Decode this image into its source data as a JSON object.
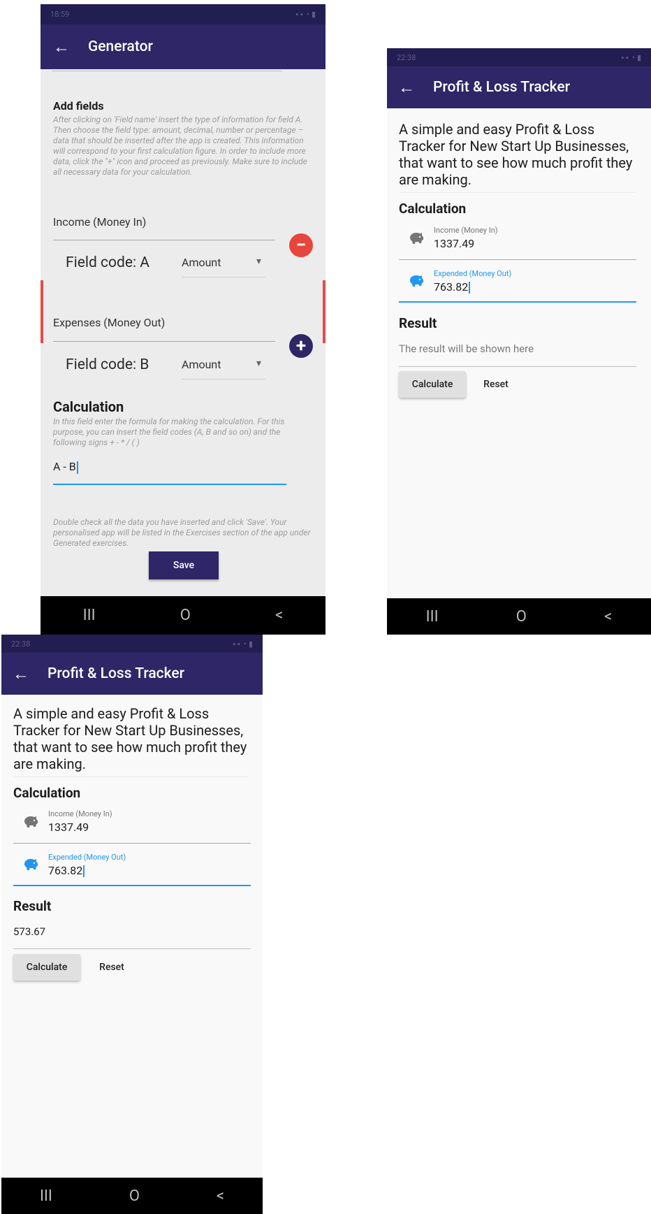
{
  "screens": {
    "generator": {
      "status_time": "18:59",
      "title": "Generator",
      "add_fields": {
        "heading": "Add fields",
        "help": "After clicking on 'Field name' insert the type of information for field A. Then choose the field type: amount, decimal, number or percentage – data that should be inserted after the app is created. This information will correspond to your first calculation figure. In order to include more data, click the \"+\" icon and proceed as previously. Make sure to include all necessary data for your calculation."
      },
      "field_a": {
        "name": "Income (Money In)",
        "code": "Field code: A",
        "type": "Amount"
      },
      "field_b": {
        "name": "Expenses (Money Out)",
        "code": "Field code: B",
        "type": "Amount"
      },
      "calculation": {
        "heading": "Calculation",
        "help": "In this field enter the formula for making the calculation. For this purpose, you can insert the field codes (A, B and so on) and the following signs + - * / ( )",
        "formula": "A - B"
      },
      "footer_help": "Double check all the data you have inserted and click 'Save'. Your personalised app will be listed in the Exercises section of the app under Generated exercises.",
      "save_label": "Save"
    },
    "tracker_empty": {
      "status_time": "22:38",
      "title": "Profit & Loss Tracker",
      "description": "A simple and easy Profit & Loss Tracker for New Start Up Businesses, that want to see how much profit they are making.",
      "calculation_heading": "Calculation",
      "income_label": "Income (Money In)",
      "income_value": "1337.49",
      "expended_label": "Expended (Money Out)",
      "expended_value": "763.82",
      "result_heading": "Result",
      "result_text": "The result will be shown here",
      "calculate_label": "Calculate",
      "reset_label": "Reset"
    },
    "tracker_result": {
      "status_time": "22:38",
      "title": "Profit & Loss Tracker",
      "description": "A simple and easy Profit & Loss Tracker for New Start Up Businesses, that want to see how much profit they are making.",
      "calculation_heading": "Calculation",
      "income_label": "Income (Money In)",
      "income_value": "1337.49",
      "expended_label": "Expended (Money Out)",
      "expended_value": "763.82",
      "result_heading": "Result",
      "result_text": "573.67",
      "calculate_label": "Calculate",
      "reset_label": "Reset"
    }
  },
  "nav": {
    "recents": "III",
    "home": "O",
    "back": "<"
  },
  "icons": {
    "back": "←",
    "remove": "−",
    "add": "+",
    "dropdown": "▾"
  },
  "colors": {
    "appbar": "#2e2667",
    "accent": "#2196f3",
    "remove": "#e8453c",
    "add": "#2e2667",
    "piggy_inactive": "#757575"
  }
}
